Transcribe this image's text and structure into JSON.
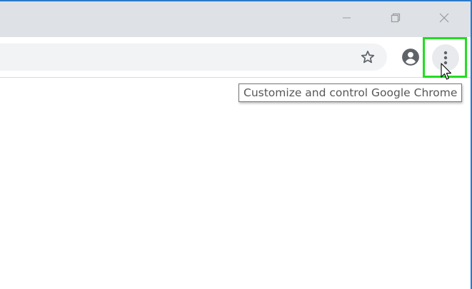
{
  "window": {
    "caption_buttons": {
      "minimize_icon": "minimize-icon",
      "restore_icon": "restore-icon",
      "close_icon": "close-icon"
    }
  },
  "toolbar": {
    "bookmark_icon": "star-icon",
    "profile_icon": "account-circle-icon",
    "menu_icon": "vertical-dots-icon"
  },
  "tooltip": {
    "text": "Customize and control Google Chrome"
  },
  "colors": {
    "titlebar": "#dee1e6",
    "omnibox": "#f1f3f4",
    "highlight": "#22dd22",
    "window_border": "#2b79c6"
  }
}
